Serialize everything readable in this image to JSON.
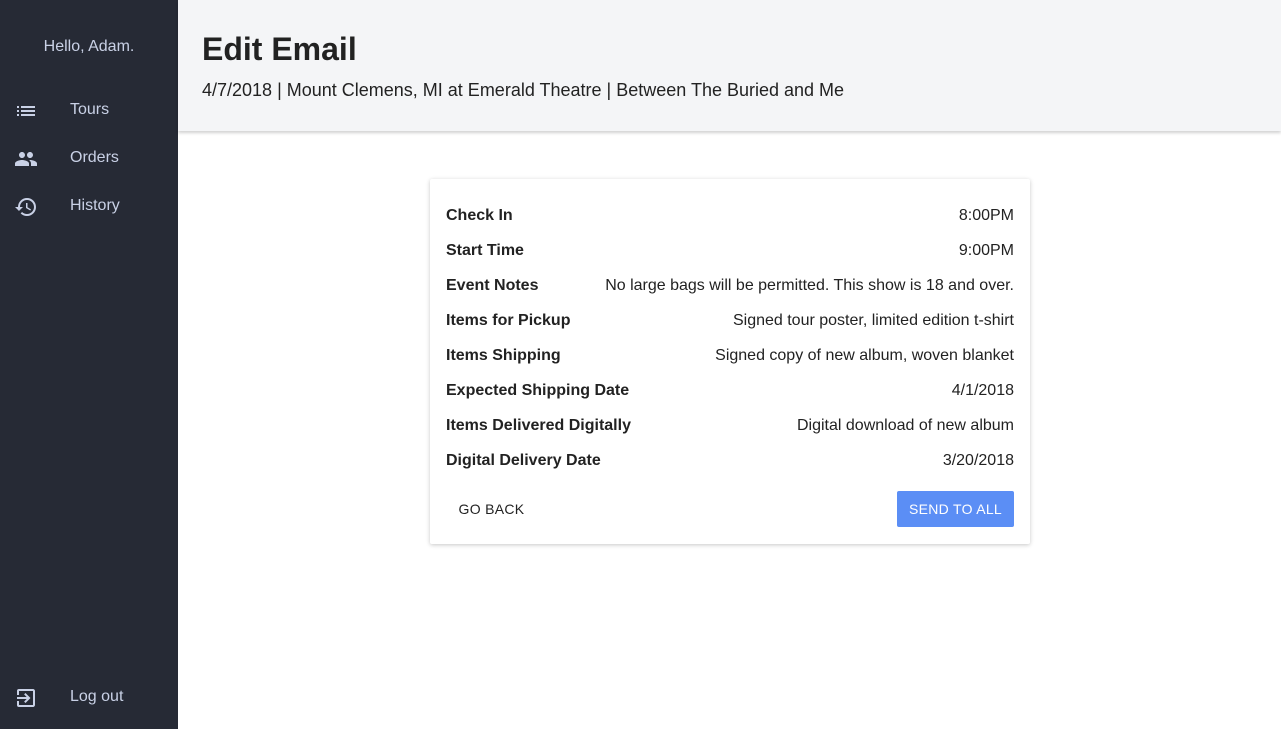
{
  "sidebar": {
    "greeting": "Hello, Adam.",
    "items": [
      {
        "label": "Tours",
        "icon": "list-icon"
      },
      {
        "label": "Orders",
        "icon": "people-icon"
      },
      {
        "label": "History",
        "icon": "history-icon"
      }
    ],
    "logout": {
      "label": "Log out",
      "icon": "exit-icon"
    }
  },
  "header": {
    "title": "Edit Email",
    "subtitle": "4/7/2018 | Mount Clemens, MI at Emerald Theatre | Between The Buried and Me"
  },
  "details": [
    {
      "label": "Check In",
      "value": "8:00PM"
    },
    {
      "label": "Start Time",
      "value": "9:00PM"
    },
    {
      "label": "Event Notes",
      "value": "No large bags will be permitted. This show is 18 and over."
    },
    {
      "label": "Items for Pickup",
      "value": "Signed tour poster, limited edition t-shirt"
    },
    {
      "label": "Items Shipping",
      "value": "Signed copy of new album, woven blanket"
    },
    {
      "label": "Expected Shipping Date",
      "value": "4/1/2018"
    },
    {
      "label": "Items Delivered Digitally",
      "value": "Digital download of new album"
    },
    {
      "label": "Digital Delivery Date",
      "value": "3/20/2018"
    }
  ],
  "actions": {
    "back_label": "GO BACK",
    "send_label": "SEND TO ALL"
  },
  "colors": {
    "sidebar_bg": "#262a35",
    "header_bg": "#f4f5f7",
    "primary": "#5b8ef5"
  }
}
